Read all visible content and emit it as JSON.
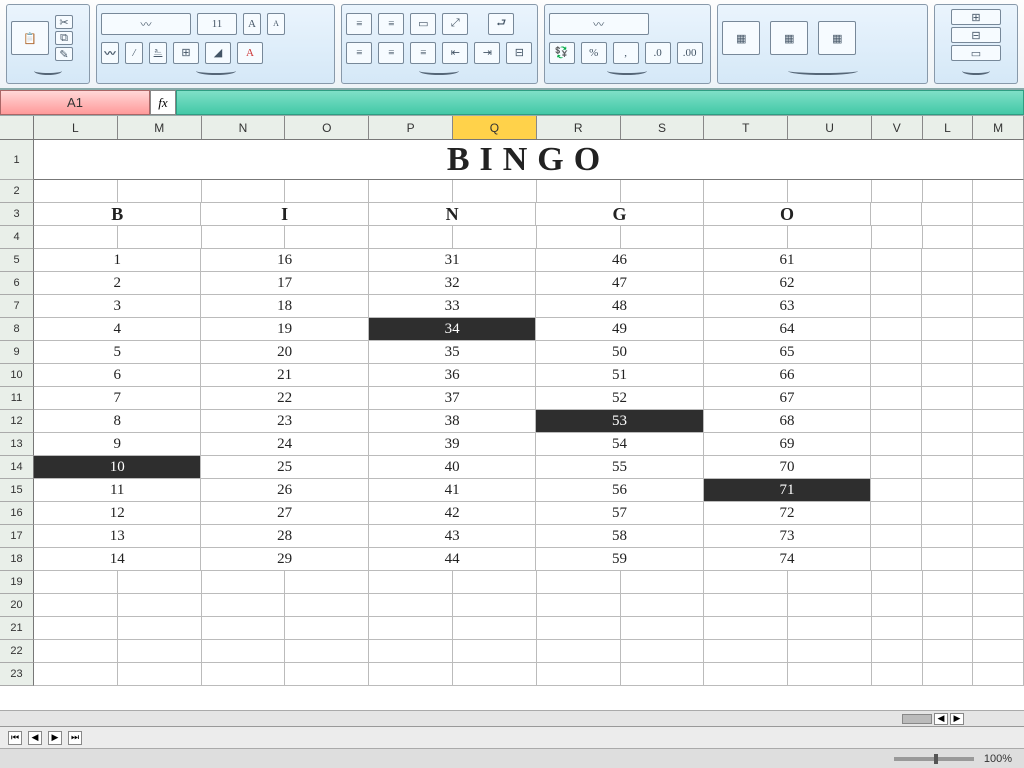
{
  "namebox": "A1",
  "zoom": "100%",
  "columns": [
    "L",
    "M",
    "N",
    "O",
    "P",
    "Q",
    "R",
    "S",
    "T",
    "U",
    "V",
    "L",
    "M"
  ],
  "active_column_index": 5,
  "title": "BINGO",
  "bingo_headers": [
    "B",
    "I",
    "N",
    "G",
    "O"
  ],
  "row_numbers": [
    1,
    2,
    3,
    4,
    5,
    6,
    7,
    8,
    9,
    10,
    11,
    12,
    13,
    14,
    15,
    16,
    17,
    18,
    19,
    20,
    21,
    22,
    23
  ],
  "rows": [
    {
      "r": 5,
      "v": [
        "1",
        "16",
        "31",
        "46",
        "61"
      ]
    },
    {
      "r": 6,
      "v": [
        "2",
        "17",
        "32",
        "47",
        "62"
      ]
    },
    {
      "r": 7,
      "v": [
        "3",
        "18",
        "33",
        "48",
        "63"
      ]
    },
    {
      "r": 8,
      "v": [
        "4",
        "19",
        "34",
        "49",
        "64"
      ],
      "hl": [
        2
      ]
    },
    {
      "r": 9,
      "v": [
        "5",
        "20",
        "35",
        "50",
        "65"
      ]
    },
    {
      "r": 10,
      "v": [
        "6",
        "21",
        "36",
        "51",
        "66"
      ]
    },
    {
      "r": 11,
      "v": [
        "7",
        "22",
        "37",
        "52",
        "67"
      ]
    },
    {
      "r": 12,
      "v": [
        "8",
        "23",
        "38",
        "53",
        "68"
      ],
      "hl": [
        3
      ]
    },
    {
      "r": 13,
      "v": [
        "9",
        "24",
        "39",
        "54",
        "69"
      ]
    },
    {
      "r": 14,
      "v": [
        "10",
        "25",
        "40",
        "55",
        "70"
      ],
      "hl": [
        0
      ]
    },
    {
      "r": 15,
      "v": [
        "11",
        "26",
        "41",
        "56",
        "71"
      ],
      "hl": [
        4
      ]
    },
    {
      "r": 16,
      "v": [
        "12",
        "27",
        "42",
        "57",
        "72"
      ]
    },
    {
      "r": 17,
      "v": [
        "13",
        "28",
        "43",
        "58",
        "73"
      ]
    },
    {
      "r": 18,
      "v": [
        "14",
        "29",
        "44",
        "59",
        "74"
      ]
    }
  ]
}
